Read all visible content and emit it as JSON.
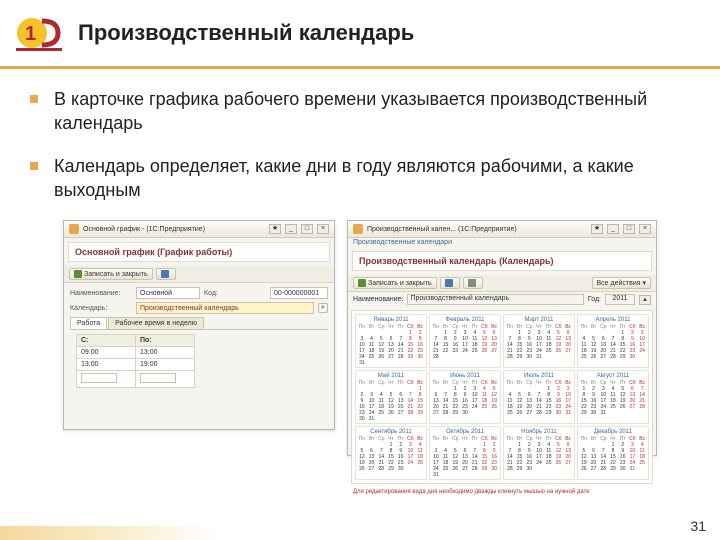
{
  "slide": {
    "title": "Производственный календарь",
    "bullets": [
      "В карточке графика рабочего времени указывается производственный календарь",
      "Календарь определяет, какие дни в году являются рабочими, а какие выходным"
    ],
    "page_number": "31"
  },
  "win1": {
    "titlebar": "Основной график - (1С:Предприятие)",
    "section": "Основной график (График работы)",
    "save_btn": "Записать и закрыть",
    "name_label": "Наименование:",
    "name_value": "Основной график",
    "code_label": "Код:",
    "code_value": "00-000000001",
    "calendar_label": "Календарь:",
    "calendar_value": "Производственный календарь",
    "tabs": [
      "Работа",
      "Рабочее время в неделю"
    ],
    "col_from": "С:",
    "col_to": "По:",
    "r1_from": "09:00",
    "r1_to": "13:00",
    "r2_from": "13:00",
    "r2_to": "19:00"
  },
  "win2": {
    "titlebar": "Производственный кален... (1С:Предприятие)",
    "crumbs": "Производственные календари",
    "section": "Производственный календарь (Календарь)",
    "name_label": "Наименование:",
    "name_value": "Производственный календарь",
    "year_label": "Год:",
    "year_value": "2011",
    "foot": "Для редактирования вида дня необходимо дважды кликнуть мышью на нужной дате",
    "months": [
      "Январь 2011",
      "Февраль 2011",
      "Март 2011",
      "Апрель 2011",
      "Май 2011",
      "Июнь 2011",
      "Июль 2011",
      "Август 2011",
      "Сентябрь 2011",
      "Октябрь 2011",
      "Ноябрь 2011",
      "Декабрь 2011"
    ],
    "weekdays": [
      "Пн",
      "Вт",
      "Ср",
      "Чт",
      "Пт",
      "Сб",
      "Вс"
    ]
  }
}
